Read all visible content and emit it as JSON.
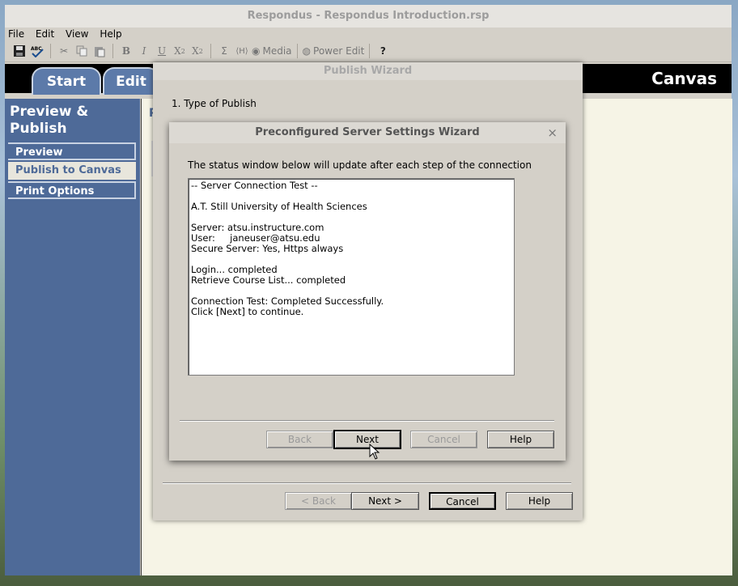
{
  "window": {
    "title": "Respondus - Respondus Introduction.rsp"
  },
  "menu": {
    "file": "File",
    "edit": "Edit",
    "view": "View",
    "help": "Help"
  },
  "toolbar": {
    "media": "Media",
    "power_edit": "Power Edit"
  },
  "tabs": {
    "start": "Start",
    "edit": "Edit",
    "brand": "Canvas"
  },
  "sidebar": {
    "heading": "Preview & Publish",
    "items": [
      {
        "label": "Preview"
      },
      {
        "label": "Publish to Canvas"
      },
      {
        "label": "Print Options"
      }
    ]
  },
  "content": {
    "fragment": "P"
  },
  "publish_wizard": {
    "title": "Publish Wizard",
    "step": "1.  Type of Publish",
    "buttons": {
      "back": "< Back",
      "next": "Next >",
      "cancel": "Cancel",
      "help": "Help"
    }
  },
  "server_wizard": {
    "title": "Preconfigured Server Settings Wizard",
    "close": "×",
    "message": "The status window below will update after each step of the connection",
    "status_lines": [
      "-- Server Connection Test --",
      "",
      "A.T. Still University of Health Sciences",
      "",
      "Server: atsu.instructure.com",
      "User:     janeuser@atsu.edu",
      "Secure Server: Yes, Https always",
      "",
      "Login... completed",
      "Retrieve Course List... completed",
      "",
      "Connection Test: Completed Successfully.",
      "Click [Next] to continue."
    ],
    "buttons": {
      "back": "Back",
      "next": "Next",
      "cancel": "Cancel",
      "help": "Help"
    }
  },
  "colors": {
    "sidebar": "#4e6a98",
    "tab_bar": "#000000",
    "content_bg": "#f6f4e6"
  }
}
